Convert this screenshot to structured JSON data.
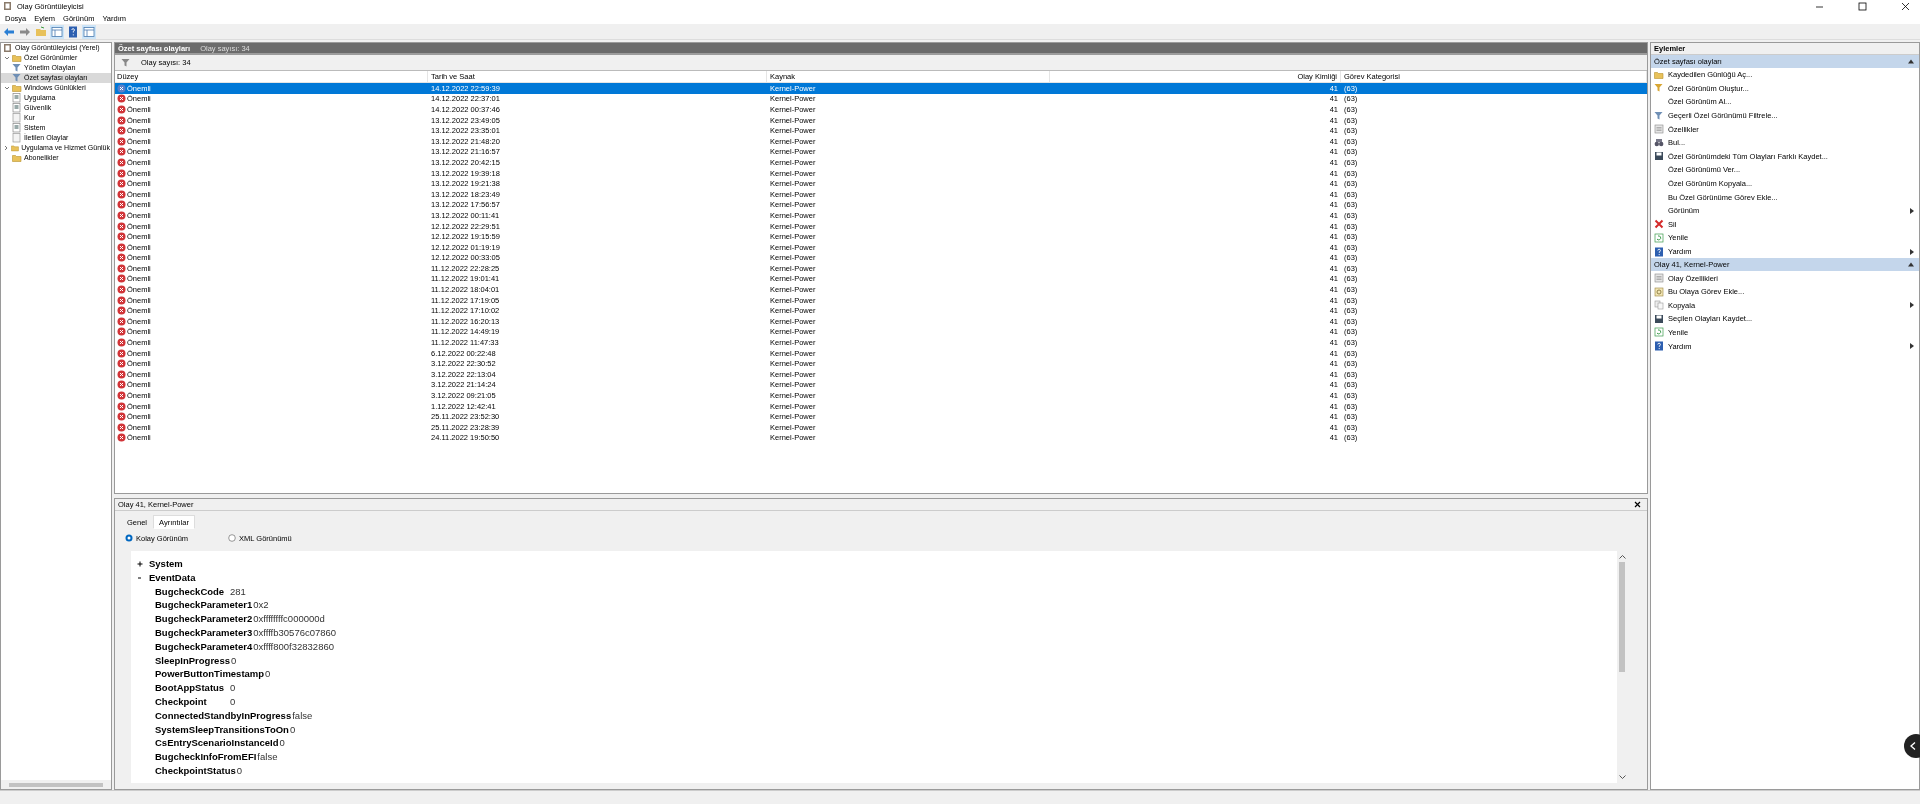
{
  "window": {
    "title": "Olay Görüntüleyicisi"
  },
  "menu": [
    "Dosya",
    "Eylem",
    "Görünüm",
    "Yardım"
  ],
  "toolbar": [
    {
      "kind": "back",
      "pressed": false
    },
    {
      "kind": "forward",
      "pressed": false
    },
    {
      "kind": "folder",
      "pressed": false
    },
    {
      "kind": "panel",
      "pressed": true
    },
    {
      "kind": "help",
      "pressed": false
    },
    {
      "kind": "panel",
      "pressed": true
    }
  ],
  "tree": [
    {
      "label": "Olay Görüntüleyicisi (Yerel)",
      "kind": "viewer",
      "selected": false,
      "children": [
        {
          "label": "Özel Görünümler",
          "kind": "folder",
          "selected": false,
          "expanded": true,
          "children": [
            {
              "label": "Yönetim Olayları",
              "kind": "filter",
              "selected": false
            },
            {
              "label": "Özet sayfası olayları",
              "kind": "filter",
              "selected": true
            }
          ]
        },
        {
          "label": "Windows Günlükleri",
          "kind": "folder",
          "selected": false,
          "expanded": true,
          "children": [
            {
              "label": "Uygulama",
              "kind": "log",
              "selected": false
            },
            {
              "label": "Güvenlik",
              "kind": "log",
              "selected": false
            },
            {
              "label": "Kur",
              "kind": "page",
              "selected": false
            },
            {
              "label": "Sistem",
              "kind": "log",
              "selected": false
            },
            {
              "label": "İletilen Olaylar",
              "kind": "page",
              "selected": false
            }
          ]
        },
        {
          "label": "Uygulama ve Hizmet Günlük",
          "kind": "folder",
          "selected": false,
          "expanded": false
        },
        {
          "label": "Abonelikler",
          "kind": "folder",
          "selected": false
        }
      ]
    }
  ],
  "view": {
    "title": "Özet sayfası olayları",
    "count": "Olay sayısı: 34",
    "filter_text": "Olay sayısı: 34"
  },
  "table": {
    "columns": [
      "Düzey",
      "Tarih ve Saat",
      "Kaynak",
      "Olay Kimliği",
      "Görev Kategorisi"
    ],
    "rows": [
      {
        "level": "Önemli",
        "date": "14.12.2022 22:59:39",
        "source": "Kernel-Power",
        "id": "41",
        "category": "(63)",
        "selected": true
      },
      {
        "level": "Önemli",
        "date": "14.12.2022 22:37:01",
        "source": "Kernel-Power",
        "id": "41",
        "category": "(63)",
        "selected": false
      },
      {
        "level": "Önemli",
        "date": "14.12.2022 00:37:46",
        "source": "Kernel-Power",
        "id": "41",
        "category": "(63)",
        "selected": false
      },
      {
        "level": "Önemli",
        "date": "13.12.2022 23:49:05",
        "source": "Kernel-Power",
        "id": "41",
        "category": "(63)",
        "selected": false
      },
      {
        "level": "Önemli",
        "date": "13.12.2022 23:35:01",
        "source": "Kernel-Power",
        "id": "41",
        "category": "(63)",
        "selected": false
      },
      {
        "level": "Önemli",
        "date": "13.12.2022 21:48:20",
        "source": "Kernel-Power",
        "id": "41",
        "category": "(63)",
        "selected": false
      },
      {
        "level": "Önemli",
        "date": "13.12.2022 21:16:57",
        "source": "Kernel-Power",
        "id": "41",
        "category": "(63)",
        "selected": false
      },
      {
        "level": "Önemli",
        "date": "13.12.2022 20:42:15",
        "source": "Kernel-Power",
        "id": "41",
        "category": "(63)",
        "selected": false
      },
      {
        "level": "Önemli",
        "date": "13.12.2022 19:39:18",
        "source": "Kernel-Power",
        "id": "41",
        "category": "(63)",
        "selected": false
      },
      {
        "level": "Önemli",
        "date": "13.12.2022 19:21:38",
        "source": "Kernel-Power",
        "id": "41",
        "category": "(63)",
        "selected": false
      },
      {
        "level": "Önemli",
        "date": "13.12.2022 18:23:49",
        "source": "Kernel-Power",
        "id": "41",
        "category": "(63)",
        "selected": false
      },
      {
        "level": "Önemli",
        "date": "13.12.2022 17:56:57",
        "source": "Kernel-Power",
        "id": "41",
        "category": "(63)",
        "selected": false
      },
      {
        "level": "Önemli",
        "date": "13.12.2022 00:11:41",
        "source": "Kernel-Power",
        "id": "41",
        "category": "(63)",
        "selected": false
      },
      {
        "level": "Önemli",
        "date": "12.12.2022 22:29:51",
        "source": "Kernel-Power",
        "id": "41",
        "category": "(63)",
        "selected": false
      },
      {
        "level": "Önemli",
        "date": "12.12.2022 19:15:59",
        "source": "Kernel-Power",
        "id": "41",
        "category": "(63)",
        "selected": false
      },
      {
        "level": "Önemli",
        "date": "12.12.2022 01:19:19",
        "source": "Kernel-Power",
        "id": "41",
        "category": "(63)",
        "selected": false
      },
      {
        "level": "Önemli",
        "date": "12.12.2022 00:33:05",
        "source": "Kernel-Power",
        "id": "41",
        "category": "(63)",
        "selected": false
      },
      {
        "level": "Önemli",
        "date": "11.12.2022 22:28:25",
        "source": "Kernel-Power",
        "id": "41",
        "category": "(63)",
        "selected": false
      },
      {
        "level": "Önemli",
        "date": "11.12.2022 19:01:41",
        "source": "Kernel-Power",
        "id": "41",
        "category": "(63)",
        "selected": false
      },
      {
        "level": "Önemli",
        "date": "11.12.2022 18:04:01",
        "source": "Kernel-Power",
        "id": "41",
        "category": "(63)",
        "selected": false
      },
      {
        "level": "Önemli",
        "date": "11.12.2022 17:19:05",
        "source": "Kernel-Power",
        "id": "41",
        "category": "(63)",
        "selected": false
      },
      {
        "level": "Önemli",
        "date": "11.12.2022 17:10:02",
        "source": "Kernel-Power",
        "id": "41",
        "category": "(63)",
        "selected": false
      },
      {
        "level": "Önemli",
        "date": "11.12.2022 16:20:13",
        "source": "Kernel-Power",
        "id": "41",
        "category": "(63)",
        "selected": false
      },
      {
        "level": "Önemli",
        "date": "11.12.2022 14:49:19",
        "source": "Kernel-Power",
        "id": "41",
        "category": "(63)",
        "selected": false
      },
      {
        "level": "Önemli",
        "date": "11.12.2022 11:47:33",
        "source": "Kernel-Power",
        "id": "41",
        "category": "(63)",
        "selected": false
      },
      {
        "level": "Önemli",
        "date": "6.12.2022 00:22:48",
        "source": "Kernel-Power",
        "id": "41",
        "category": "(63)",
        "selected": false
      },
      {
        "level": "Önemli",
        "date": "3.12.2022 22:30:52",
        "source": "Kernel-Power",
        "id": "41",
        "category": "(63)",
        "selected": false
      },
      {
        "level": "Önemli",
        "date": "3.12.2022 22:13:04",
        "source": "Kernel-Power",
        "id": "41",
        "category": "(63)",
        "selected": false
      },
      {
        "level": "Önemli",
        "date": "3.12.2022 21:14:24",
        "source": "Kernel-Power",
        "id": "41",
        "category": "(63)",
        "selected": false
      },
      {
        "level": "Önemli",
        "date": "3.12.2022 09:21:05",
        "source": "Kernel-Power",
        "id": "41",
        "category": "(63)",
        "selected": false
      },
      {
        "level": "Önemli",
        "date": "1.12.2022 12:42:41",
        "source": "Kernel-Power",
        "id": "41",
        "category": "(63)",
        "selected": false
      },
      {
        "level": "Önemli",
        "date": "25.11.2022 23:52:30",
        "source": "Kernel-Power",
        "id": "41",
        "category": "(63)",
        "selected": false
      },
      {
        "level": "Önemli",
        "date": "25.11.2022 23:28:39",
        "source": "Kernel-Power",
        "id": "41",
        "category": "(63)",
        "selected": false
      },
      {
        "level": "Önemli",
        "date": "24.11.2022 19:50:50",
        "source": "Kernel-Power",
        "id": "41",
        "category": "(63)",
        "selected": false
      }
    ]
  },
  "details": {
    "title": "Olay 41, Kernel-Power",
    "tabs": [
      {
        "label": "Genel",
        "selected": false
      },
      {
        "label": "Ayrıntılar",
        "selected": true
      }
    ],
    "views": [
      {
        "label": "Kolay Görünüm",
        "selected": true
      },
      {
        "label": "XML Görünümü",
        "selected": false
      }
    ],
    "sections": [
      {
        "label": "System",
        "expanded": false
      },
      {
        "label": "EventData",
        "expanded": true,
        "fields": [
          {
            "name": "BugcheckCode",
            "value": "281"
          },
          {
            "name": "BugcheckParameter1",
            "value": "0x2"
          },
          {
            "name": "BugcheckParameter2",
            "value": "0xffffffffc000000d"
          },
          {
            "name": "BugcheckParameter3",
            "value": "0xffffb30576c07860"
          },
          {
            "name": "BugcheckParameter4",
            "value": "0xffff800f32832860"
          },
          {
            "name": "SleepInProgress",
            "value": "0"
          },
          {
            "name": "PowerButtonTimestamp",
            "value": "0"
          },
          {
            "name": "BootAppStatus",
            "value": "0"
          },
          {
            "name": "Checkpoint",
            "value": "0"
          },
          {
            "name": "ConnectedStandbyInProgress",
            "value": "false"
          },
          {
            "name": "SystemSleepTransitionsToOn",
            "value": "0"
          },
          {
            "name": "CsEntryScenarioInstanceId",
            "value": "0"
          },
          {
            "name": "BugcheckInfoFromEFI",
            "value": "false"
          },
          {
            "name": "CheckpointStatus",
            "value": "0"
          }
        ]
      }
    ]
  },
  "actions": {
    "title": "Eylemler",
    "sections": [
      {
        "title": "Özet sayfası olayları",
        "expanded": true,
        "items": [
          {
            "label": "Kaydedilen Günlüğü Aç...",
            "kind": "folder",
            "submenu": false
          },
          {
            "label": "Özel Görünüm Oluştur...",
            "kind": "filter-new",
            "submenu": false
          },
          {
            "label": "Özel Görünüm Al...",
            "kind": "none",
            "submenu": false
          },
          {
            "label": "Geçerli Özel Görünümü Filtrele...",
            "kind": "filter",
            "submenu": false
          },
          {
            "label": "Özellikler",
            "kind": "properties",
            "submenu": false
          },
          {
            "label": "Bul...",
            "kind": "find",
            "submenu": false
          },
          {
            "label": "Özel Görünümdeki Tüm Olayları Farklı Kaydet...",
            "kind": "save",
            "submenu": false
          },
          {
            "label": "Özel Görünümü Ver...",
            "kind": "none",
            "submenu": false
          },
          {
            "label": "Özel Görünüm Kopyala...",
            "kind": "none",
            "submenu": false
          },
          {
            "label": "Bu Özel Görünüme Görev Ekle...",
            "kind": "none",
            "submenu": false
          },
          {
            "label": "Görünüm",
            "kind": "none",
            "submenu": true
          },
          {
            "label": "Sil",
            "kind": "delete",
            "submenu": false
          },
          {
            "label": "Yenile",
            "kind": "refresh",
            "submenu": false
          },
          {
            "label": "Yardım",
            "kind": "help",
            "submenu": true
          }
        ]
      },
      {
        "title": "Olay 41, Kernel-Power",
        "expanded": true,
        "items": [
          {
            "label": "Olay Özellikleri",
            "kind": "properties",
            "submenu": false
          },
          {
            "label": "Bu Olaya Görev Ekle...",
            "kind": "task",
            "submenu": false
          },
          {
            "label": "Kopyala",
            "kind": "copy",
            "submenu": true
          },
          {
            "label": "Seçilen Olayları Kaydet...",
            "kind": "save",
            "submenu": false
          },
          {
            "label": "Yenile",
            "kind": "refresh",
            "submenu": false
          },
          {
            "label": "Yardım",
            "kind": "help",
            "submenu": true
          }
        ]
      }
    ]
  }
}
